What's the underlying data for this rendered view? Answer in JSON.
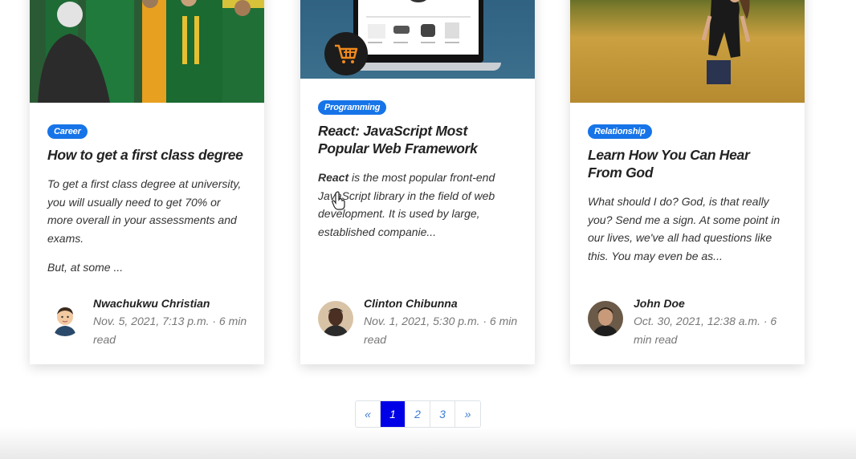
{
  "cards": [
    {
      "category": "Career",
      "title": "How to get a first class degree",
      "excerpt": "To get a first class degree at university, you will usually need to get 70% or more overall in your assessments and exams.",
      "excerpt_more": "But, at some ...",
      "author": "Nwachukwu Christian",
      "meta": "Nov. 5, 2021, 7:13 p.m. · 6 min read",
      "image": "graduates-photo",
      "avatar": "cartoon-avatar"
    },
    {
      "category": "Programming",
      "title": "React: JavaScript Most Popular Web Framework",
      "excerpt_bold": "React",
      "excerpt": " is the most popular front-end JavaScript library in the field of web development. It is used by large, established companie...",
      "author": "Clinton Chibunna",
      "meta": "Nov. 1, 2021, 5:30 p.m. · 6 min read",
      "image": "laptop-ecommerce-photo",
      "avatar": "photo-avatar"
    },
    {
      "category": "Relationship",
      "title": "Learn How You Can Hear From God",
      "excerpt": "What should I do? God, is that really you? Send me a sign. At some point in our lives, we've all had questions like this. You may even be as...",
      "author": "John Doe",
      "meta": "Oct. 30, 2021, 12:38 a.m. · 6 min read",
      "image": "woman-in-wheat-field-photo",
      "avatar": "photo-avatar"
    }
  ],
  "pagination": {
    "prev": "«",
    "pages": [
      "1",
      "2",
      "3"
    ],
    "active": "1",
    "next": "»"
  },
  "colors": {
    "tag": "#1674e8",
    "active_page": "#0000e6",
    "link": "#3a7bd5"
  },
  "icons": [
    "shopping-cart-icon",
    "hand-pointer-cursor-icon"
  ]
}
